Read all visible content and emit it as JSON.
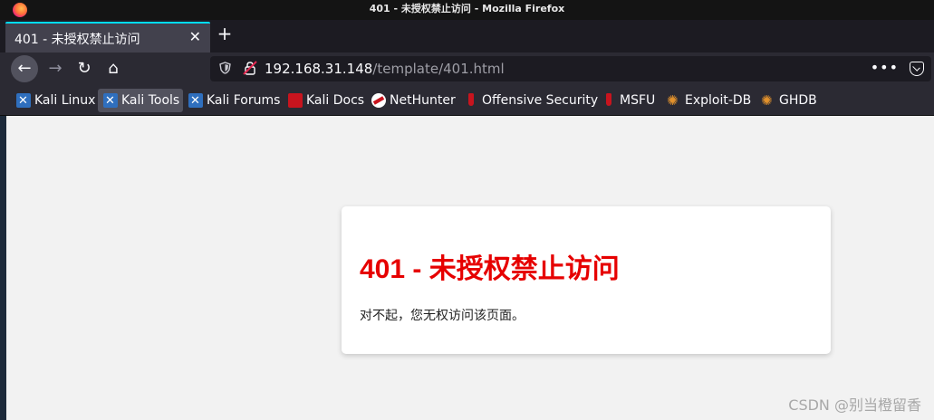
{
  "window": {
    "title": "401 - 未授权禁止访问 - Mozilla Firefox"
  },
  "tab": {
    "title": "401 - 未授权禁止访问",
    "close": "✕"
  },
  "new_tab": "+",
  "nav": {
    "back": "←",
    "forward": "→",
    "reload": "↻",
    "home": "⌂"
  },
  "url": {
    "host": "192.168.31.148",
    "path": "/template/401.html"
  },
  "url_actions": {
    "more": "•••"
  },
  "bookmarks": [
    {
      "label": "Kali Linux",
      "icon": "kali-icon"
    },
    {
      "label": "Kali Tools",
      "icon": "kali-icon"
    },
    {
      "label": "Kali Forums",
      "icon": "kali-icon"
    },
    {
      "label": "Kali Docs",
      "icon": "docs-icon"
    },
    {
      "label": "NetHunter",
      "icon": "nethunter-icon"
    },
    {
      "label": "Offensive Security",
      "icon": "offsec-icon"
    },
    {
      "label": "MSFU",
      "icon": "offsec-icon"
    },
    {
      "label": "Exploit-DB",
      "icon": "exploitdb-icon"
    },
    {
      "label": "GHDB",
      "icon": "exploitdb-icon"
    }
  ],
  "page": {
    "heading": "401 - 未授权禁止访问",
    "message": "对不起，您无权访问该页面。"
  },
  "watermark": "CSDN @别当橙留香",
  "colors": {
    "heading": "#e60000",
    "tab_accent": "#00ddff"
  }
}
